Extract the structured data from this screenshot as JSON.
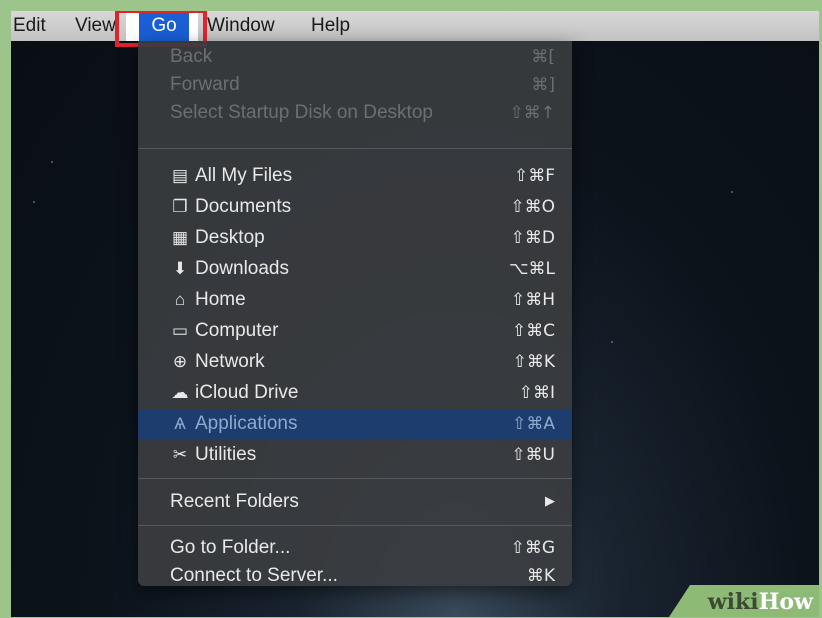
{
  "menubar": {
    "items": [
      "Edit",
      "View",
      "Go",
      "Window",
      "Help"
    ]
  },
  "menu": {
    "nav": [
      {
        "label": "Back",
        "shortcut": "⌘[",
        "enabled": false
      },
      {
        "label": "Forward",
        "shortcut": "⌘]",
        "enabled": false
      },
      {
        "label": "Select Startup Disk on Desktop",
        "shortcut": "⇧⌘↑",
        "enabled": false
      }
    ],
    "places": [
      {
        "label": "All My Files",
        "shortcut": "⇧⌘F",
        "icon": "files-icon"
      },
      {
        "label": "Documents",
        "shortcut": "⇧⌘O",
        "icon": "documents-icon"
      },
      {
        "label": "Desktop",
        "shortcut": "⇧⌘D",
        "icon": "desktop-icon"
      },
      {
        "label": "Downloads",
        "shortcut": "⌥⌘L",
        "icon": "downloads-icon"
      },
      {
        "label": "Home",
        "shortcut": "⇧⌘H",
        "icon": "home-icon"
      },
      {
        "label": "Computer",
        "shortcut": "⇧⌘C",
        "icon": "computer-icon"
      },
      {
        "label": "Network",
        "shortcut": "⇧⌘K",
        "icon": "network-icon"
      },
      {
        "label": "iCloud Drive",
        "shortcut": "⇧⌘I",
        "icon": "cloud-icon"
      },
      {
        "label": "Applications",
        "shortcut": "⇧⌘A",
        "icon": "applications-icon",
        "selected": true
      },
      {
        "label": "Utilities",
        "shortcut": "⇧⌘U",
        "icon": "utilities-icon"
      }
    ],
    "recent": {
      "label": "Recent Folders",
      "arrow": "▶"
    },
    "goto": [
      {
        "label": "Go to Folder...",
        "shortcut": "⇧⌘G"
      },
      {
        "label": "Connect to Server...",
        "shortcut": "⌘K"
      }
    ]
  },
  "watermark": {
    "part1": "wiki",
    "part2": "How"
  }
}
